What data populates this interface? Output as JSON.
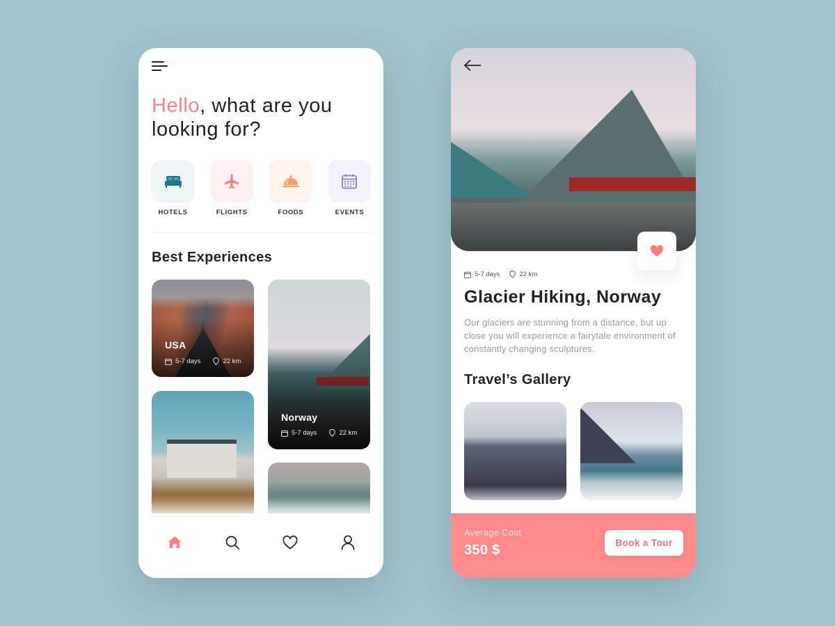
{
  "colors": {
    "background": "#a2c3cb",
    "accent": "#fb8383",
    "booking_bar": "#fd8b8b",
    "hotels": "#1b7a8a",
    "flights": "#fb7f7f",
    "foods": "#ff9a66",
    "events": "#8a7cd0"
  },
  "home": {
    "menu_icon": "hamburger-menu-icon",
    "greeting": {
      "accent": "Hello",
      "rest": ", what are you looking for?"
    },
    "categories": [
      {
        "label": "HOTELS",
        "icon": "bed-icon"
      },
      {
        "label": "FLIGHTS",
        "icon": "airplane-icon"
      },
      {
        "label": "FOODS",
        "icon": "food-cloche-icon"
      },
      {
        "label": "EVENTS",
        "icon": "calendar-icon"
      }
    ],
    "section_title": "Best Experiences",
    "experiences": [
      {
        "name": "USA",
        "duration": "5-7 days",
        "distance": "22 km"
      },
      {
        "name": "Norway",
        "duration": "5-7 days",
        "distance": "22 km"
      },
      {
        "name": "",
        "duration": "",
        "distance": ""
      },
      {
        "name": "",
        "duration": "",
        "distance": ""
      }
    ],
    "bottom_nav": [
      {
        "icon": "home-icon",
        "active": true
      },
      {
        "icon": "search-icon",
        "active": false
      },
      {
        "icon": "heart-icon",
        "active": false
      },
      {
        "icon": "user-icon",
        "active": false
      }
    ]
  },
  "detail": {
    "back_icon": "arrow-left-icon",
    "favorite_icon": "heart-icon",
    "duration": "5-7 days",
    "distance": "22 km",
    "title": "Glacier Hiking, Norway",
    "description": "Our glaciers are stunning from a distance, but up close you will experience a fairytale environment of constantly changing sculptures.",
    "gallery_title": "Travel’s Gallery",
    "gallery_count": 2,
    "average_cost_label": "Average Cost",
    "average_cost": "350 $",
    "book_button": "Book a Tour"
  }
}
